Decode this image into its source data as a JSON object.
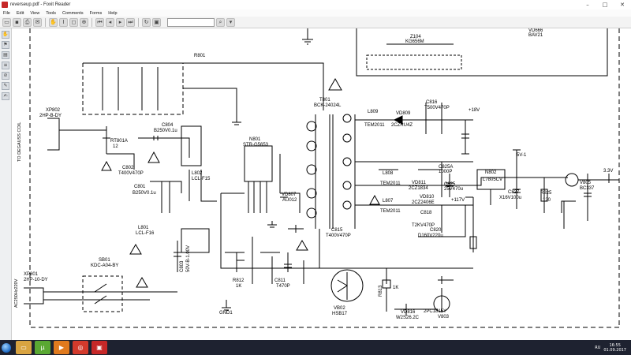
{
  "window": {
    "title": "reverseup.pdf - Foxit Reader"
  },
  "menu": [
    "File",
    "Edit",
    "View",
    "Tools",
    "Comments",
    "Forms",
    "Help"
  ],
  "sidebar_icons": [
    "hand-tool-icon",
    "bookmark-icon",
    "pages-icon",
    "layers-icon",
    "attachment-icon",
    "comments-icon",
    "signature-icon"
  ],
  "schematic": {
    "coil_label": "TO DEGAUSS COIL",
    "parts": {
      "xp802": "XP802",
      "xp802_sub": "2HP-B-DY",
      "rt801": "RT801A",
      "rt801_val": "12",
      "c802": "C802",
      "c802_val": "T400V470P",
      "c801": "C801",
      "c801_val": "B250V0.1u",
      "c804": "C804",
      "c804_val": "B250V0.1u",
      "l802": "L802",
      "l802_val": "LCL-F15",
      "l801": "L801",
      "l801_val": "LCL-F16",
      "xp801": "XP801",
      "xp801_sub": "2HP-10-DY",
      "sb01": "SB01",
      "sb01_val": "KDC-A04-BY",
      "mains": "AC250Hz220V",
      "r801": "R801",
      "n801": "N801",
      "n801_val": "STR-G5653",
      "t801": "T801",
      "t801_val": "BCK-24024L",
      "l809": "L809",
      "l809_val": "TEM2011",
      "c816": "C816",
      "c816_val": "T500V470P",
      "vd809": "VD809",
      "vd809_val": "2CZRU4Z",
      "v18": "+18V",
      "l808": "L808",
      "l808_val": "TEM2011",
      "c825a": "C825A",
      "c825a_val": "1000P",
      "vd811": "VD811",
      "vd811_val": "2CZ1834",
      "c825": "C825",
      "c825_val": "25V470u",
      "n802": "N802",
      "n802_val": "L7805CV",
      "v5": "5V-1",
      "c827": "C827",
      "c827_val": "X16V100u",
      "r825": "R825",
      "r825_val": "120",
      "v805": "V805",
      "v805_val": "BC337",
      "v33": "3.3V",
      "l807": "L807",
      "l807_val": "TEM2011",
      "vd810": "VD810",
      "vd810_val": "2CZ2406E",
      "v117": "+117V",
      "c818": "C818",
      "c818_val": "T2KV470P",
      "c820": "C820",
      "c820_val": "D160V220u",
      "c815": "C815",
      "c815_val": "T400V470P",
      "vd816": "VD816",
      "vd816_val": "W2S26.2C",
      "v803": "V803",
      "v803_val": "2PC1815Y",
      "vb02": "VB02",
      "vb02_val": "HSB17",
      "r813": "R813",
      "r813_val": "1K",
      "z104": "Z104",
      "z104_val": "KG656M",
      "vd666": "VD666",
      "vd666_val": "BAV21",
      "gnd1": "GND1",
      "c811": "C811",
      "c811_val": "T470P",
      "vd807": "VD807",
      "vd807_val": "AU012",
      "c803": "C803",
      "c803_val": "50V-B-1.00V",
      "r812": "R812",
      "r812_val": "1K"
    }
  },
  "taskbar": {
    "lang": "RU",
    "time": "16:55",
    "date": "01.09.2017"
  }
}
